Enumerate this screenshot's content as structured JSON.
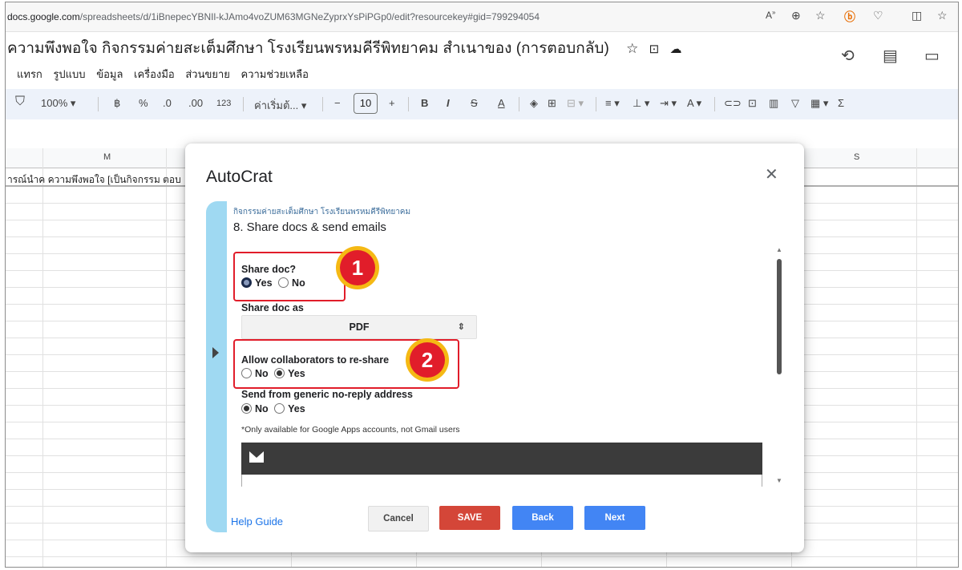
{
  "browser": {
    "url_domain": "docs.google.com",
    "url_path": "/spreadsheets/d/1iBnepecYBNIl-kJAmo4voZUM63MGNeZyprxYsPiPGp0/edit?resourcekey#gid=799294054",
    "icons": [
      "read-aloud-icon",
      "zoom-icon",
      "favorite-icon",
      "extension-icon",
      "browser-essentials-icon",
      "split-screen-icon",
      "collections-icon"
    ]
  },
  "sheet": {
    "title": "ความพึงพอใจ กิจกรรมค่ายสะเต็มศึกษา โรงเรียนพรหมคีรีพิทยาคม สำเนาของ (การตอบกลับ)",
    "menus": [
      "แทรก",
      "รูปแบบ",
      "ข้อมูล",
      "เครื่องมือ",
      "ส่วนขยาย",
      "ความช่วยเหลือ"
    ],
    "toolbar": {
      "zoom": "100%",
      "currency": "฿",
      "percent": "%",
      "dec_decrease": ".0",
      "dec_increase": ".00",
      "number_format": "123",
      "font": "ค่าเริ่มต้...",
      "font_size": "10"
    },
    "columns": [
      "M",
      "S"
    ],
    "cell_text": "ารณ์นำค ความพึงพอใจ [เป็นกิจกรรม ตอบ"
  },
  "dialog": {
    "title": "AutoCrat",
    "crumb": "กิจกรรมค่ายสะเต็มศึกษา โรงเรียนพรหมคีรีพิทยาคม",
    "step": "8. Share docs & send emails",
    "share_doc": {
      "label": "Share doc?",
      "yes": "Yes",
      "no": "No"
    },
    "share_as": {
      "label": "Share doc as",
      "value": "PDF"
    },
    "reshare": {
      "label": "Allow collaborators to re-share",
      "no": "No",
      "yes": "Yes"
    },
    "noreply": {
      "label": "Send from generic no-reply address",
      "no": "No",
      "yes": "Yes"
    },
    "note": "*Only available for Google Apps accounts, not Gmail users",
    "help": "Help Guide",
    "buttons": {
      "cancel": "Cancel",
      "save": "SAVE",
      "back": "Back",
      "next": "Next"
    }
  },
  "annotations": {
    "badge1": "1",
    "badge2": "2"
  },
  "colors": {
    "highlight": "#e11d2a",
    "badge_ring": "#f5b914",
    "save": "#d44638",
    "primary": "#4285f4",
    "strip": "#9fd9f2"
  }
}
